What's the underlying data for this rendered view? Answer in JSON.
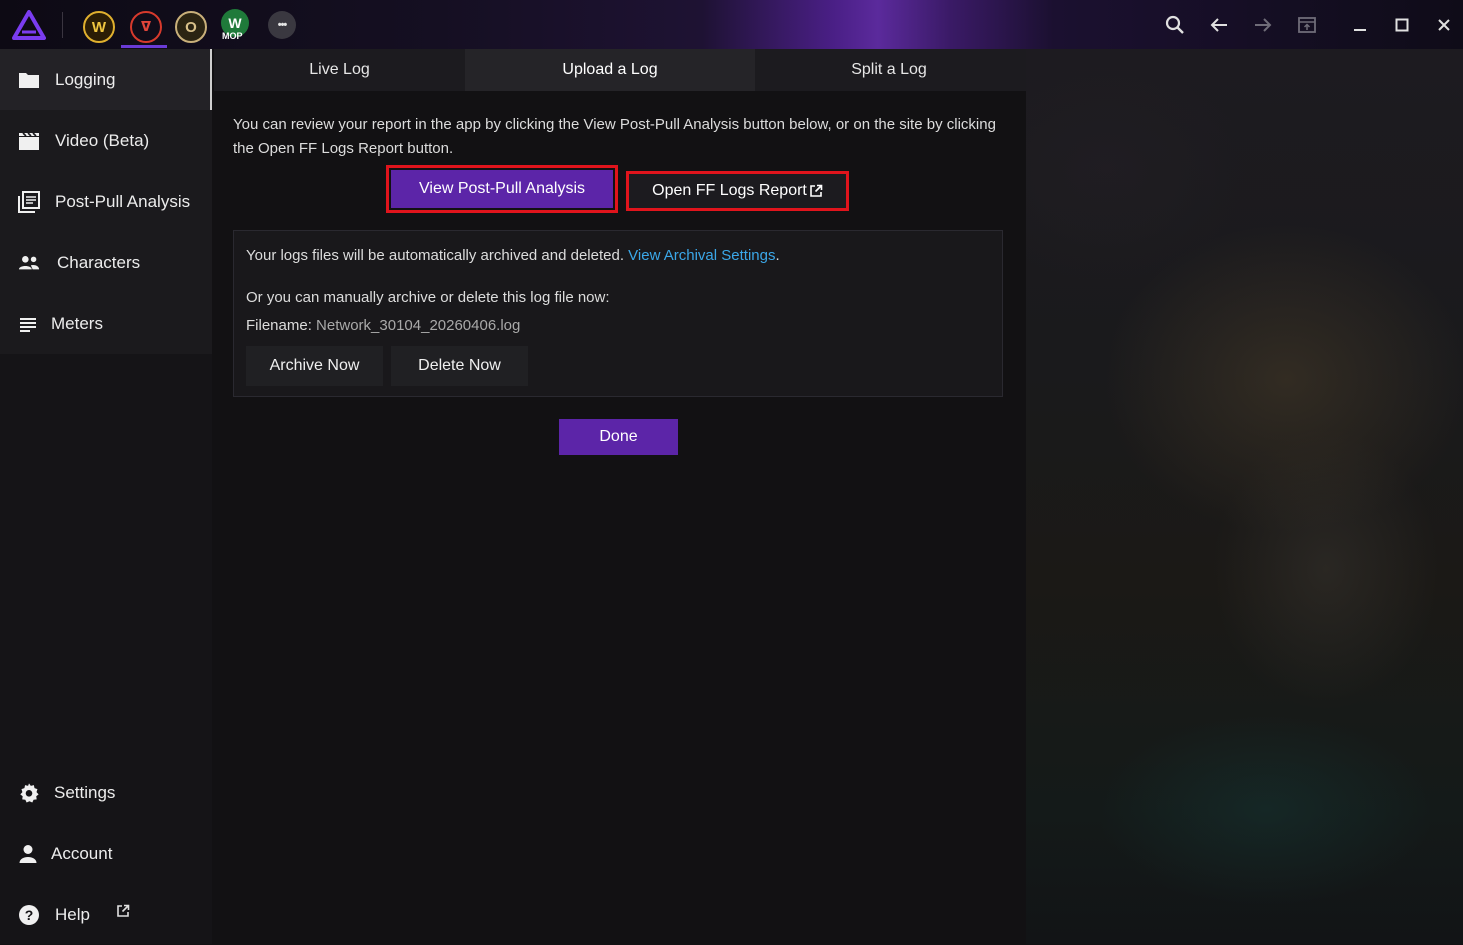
{
  "titlebar": {
    "games": [
      {
        "icon": "wow-icon",
        "glyph": "W"
      },
      {
        "icon": "ffxiv-icon",
        "glyph": "ᐁ"
      },
      {
        "icon": "eso-icon",
        "glyph": "O"
      },
      {
        "icon": "wow-mop-icon",
        "glyph": "W",
        "badge": "MOP"
      }
    ],
    "more": "•••"
  },
  "sidebar": {
    "items": [
      {
        "label": "Logging",
        "icon": "folder-icon"
      },
      {
        "label": "Video (Beta)",
        "icon": "clapperboard-icon"
      },
      {
        "label": "Post-Pull Analysis",
        "icon": "report-icon"
      },
      {
        "label": "Characters",
        "icon": "people-icon"
      },
      {
        "label": "Meters",
        "icon": "list-icon"
      }
    ],
    "bottom": [
      {
        "label": "Settings",
        "icon": "gear-icon"
      },
      {
        "label": "Account",
        "icon": "person-icon"
      },
      {
        "label": "Help",
        "icon": "help-icon"
      }
    ]
  },
  "tabs": [
    "Live Log",
    "Upload a Log",
    "Split a Log"
  ],
  "description": "You can review your report in the app by clicking the View Post-Pull Analysis button below, or on the site by clicking the Open FF Logs Report button.",
  "buttons": {
    "view_analysis": "View Post-Pull Analysis",
    "open_report": "Open FF Logs Report",
    "archive": "Archive Now",
    "delete": "Delete Now",
    "done": "Done"
  },
  "archive": {
    "auto_text": "Your logs files will be automatically archived and deleted.",
    "settings_link": "View Archival Settings",
    "period": ".",
    "manual_text": "Or you can manually archive or delete this log file now:",
    "filename_label": "Filename:",
    "filename": "Network_30104_20260406.log"
  },
  "colors": {
    "accent": "#5c25a8",
    "highlight": "#e0141c",
    "link": "#3ba7e8"
  }
}
